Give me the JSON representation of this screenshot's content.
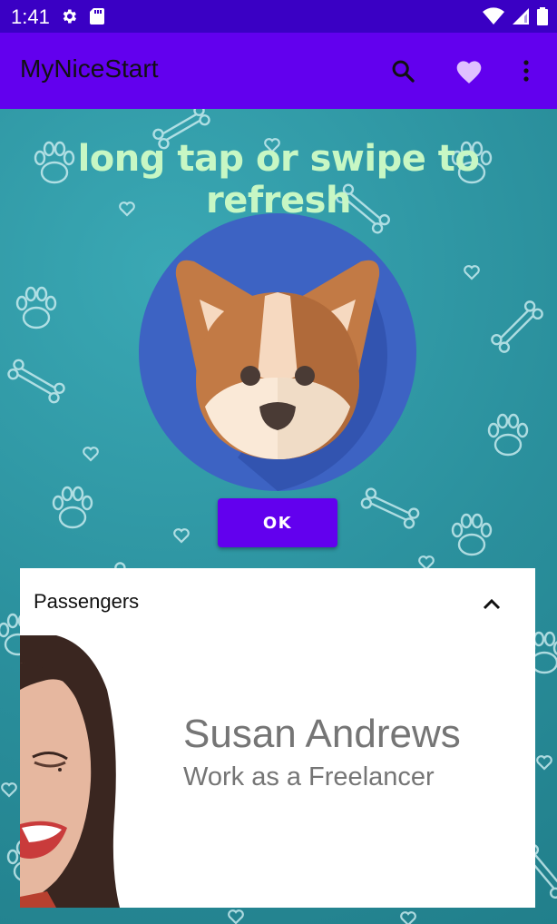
{
  "status_bar": {
    "time": "1:41",
    "left_icons": [
      "settings-icon",
      "sd-card-icon"
    ],
    "right_icons": [
      "wifi-icon",
      "signal-icon",
      "battery-icon"
    ]
  },
  "app_bar": {
    "title": "MyNiceStart",
    "actions": [
      "search-icon",
      "heart-icon",
      "overflow-menu-icon"
    ]
  },
  "main": {
    "refresh_hint": "long tap or swipe to refresh",
    "ok_label": "OK"
  },
  "card": {
    "title": "Passengers",
    "name": "Susan Andrews",
    "role": "Work as a Freelancer"
  },
  "colors": {
    "status_bar": "#3a00c4",
    "app_bar": "#6200ee",
    "button": "#6200ee",
    "refresh_text": "#c7f7c4",
    "background": "#2a8f9c",
    "avatar_circle": "#3d63c3"
  }
}
